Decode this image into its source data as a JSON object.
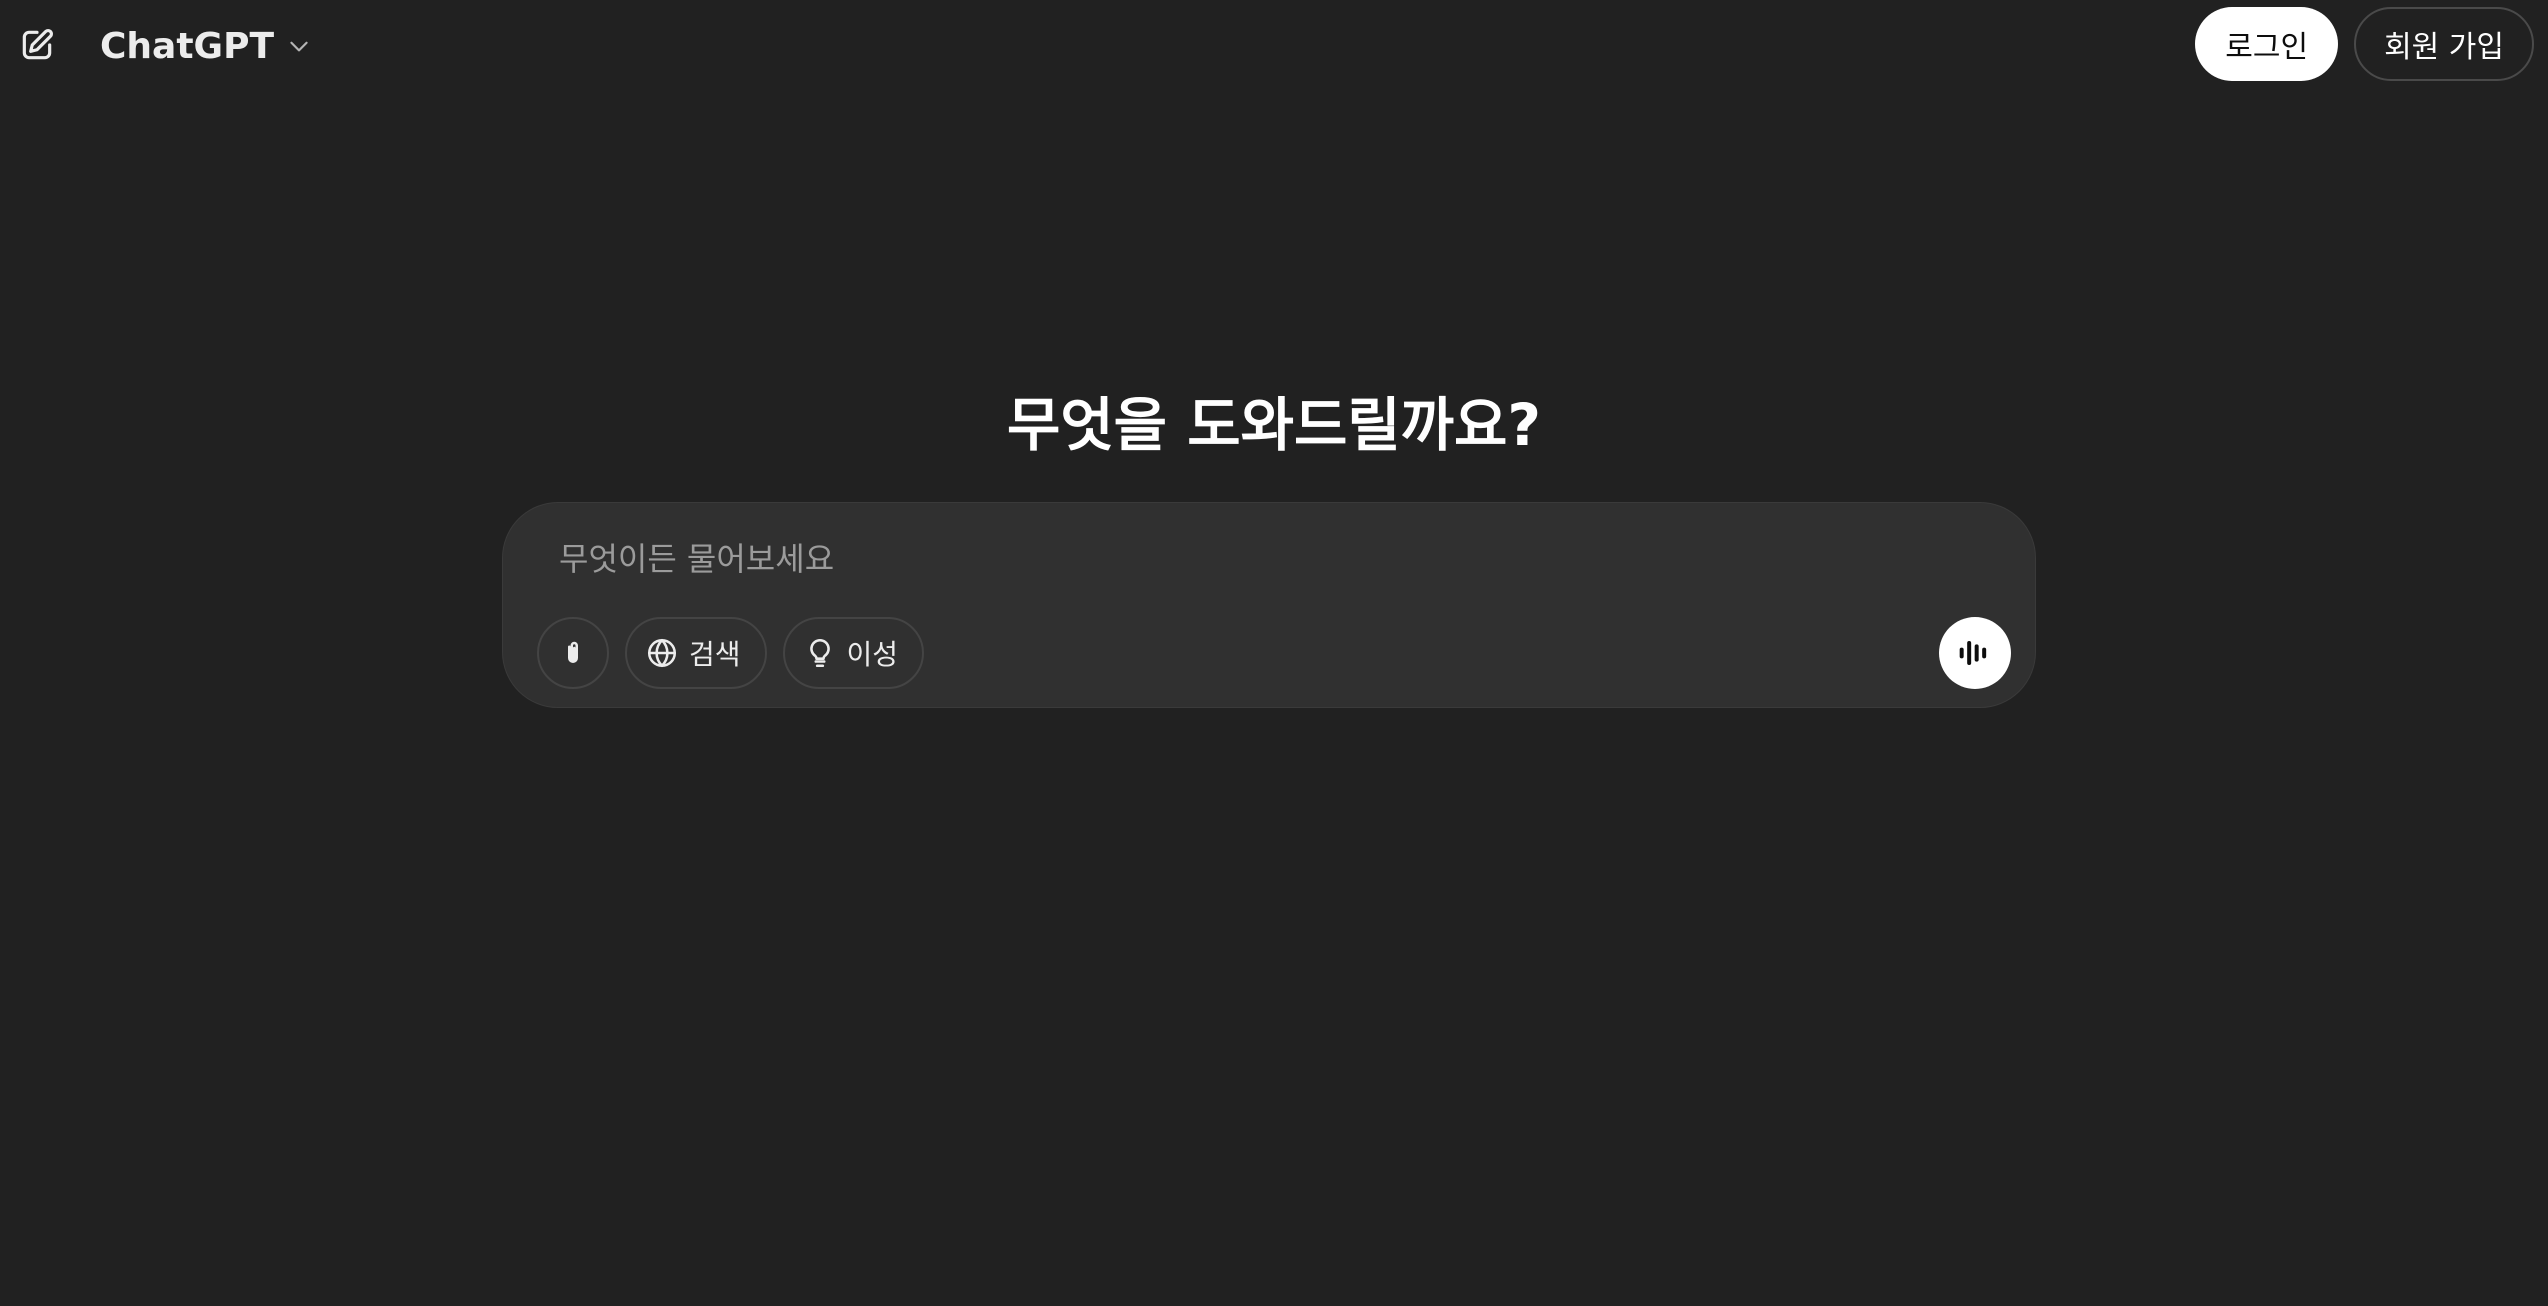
{
  "header": {
    "new_chat_icon": "edit-square-icon",
    "model_name": "ChatGPT",
    "model_chevron_icon": "chevron-down-icon",
    "login_label": "로그인",
    "signup_label": "회원 가입"
  },
  "main": {
    "headline": "무엇을 도와드릴까요?",
    "composer": {
      "placeholder": "무엇이든 물어보세요",
      "value": "",
      "attach_icon": "paperclip-icon",
      "search_label": "검색",
      "search_icon": "globe-icon",
      "reason_label": "이성",
      "reason_icon": "lightbulb-icon",
      "voice_icon": "voice-waveform-icon"
    }
  },
  "colors": {
    "background": "#212121",
    "composer_bg": "#303030",
    "text": "#ffffff",
    "placeholder": "#9b9b9b",
    "login_bg": "#ffffff",
    "login_text": "#0d0d0d"
  }
}
